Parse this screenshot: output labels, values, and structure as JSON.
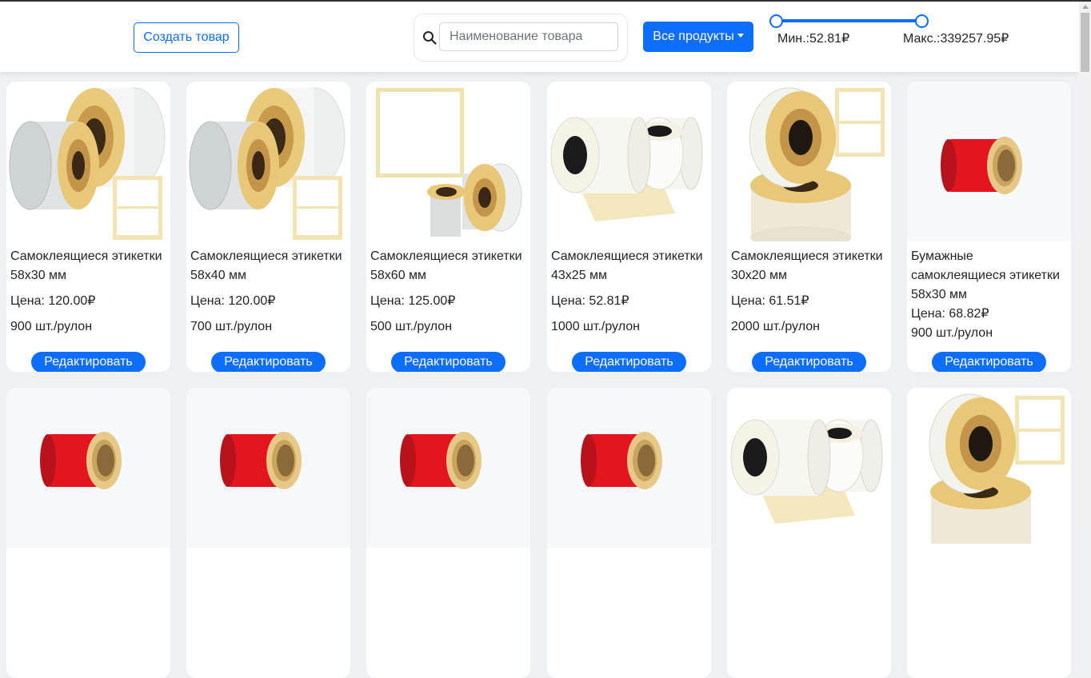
{
  "header": {
    "create_button": "Создать товар",
    "search": {
      "placeholder": "Наименование товара",
      "value": ""
    },
    "filter_button": "Все продукты",
    "price_slider": {
      "min_label": "Мин.:52.81₽",
      "max_label": "Макс.:339257.95₽",
      "min_value": 52.81,
      "max_value": 339257.95
    }
  },
  "colors": {
    "accent": "#0d6efd",
    "label_red": "#e3161f",
    "label_white": "#f5f6f2",
    "paper_core": "#d8c38a"
  },
  "products": [
    {
      "title": "Самоклеящиеся этикетки 58х30 мм",
      "price": "Цена: 120.00₽",
      "qty": "900 шт./рулон",
      "edit": "Редактировать",
      "image": "white-rolls-with-sheet"
    },
    {
      "title": "Самоклеящиеся этикетки 58х40 мм",
      "price": "Цена: 120.00₽",
      "qty": "700 шт./рулон",
      "edit": "Редактировать",
      "image": "white-rolls-with-sheet"
    },
    {
      "title": "Самоклеящиеся этикетки 58х60 мм",
      "price": "Цена: 125.00₽",
      "qty": "500 шт./рулон",
      "edit": "Редактировать",
      "image": "white-roll-with-big-sheet"
    },
    {
      "title": "Самоклеящиеся этикетки 43х25 мм",
      "price": "Цена: 52.81₽",
      "qty": "1000 шт./рулон",
      "edit": "Редактировать",
      "image": "white-rolls-unrolled"
    },
    {
      "title": "Самоклеящиеся этикетки 30х20 мм",
      "price": "Цена: 61.51₽",
      "qty": "2000 шт./рулон",
      "edit": "Редактировать",
      "image": "stacked-rolls-with-sheet"
    },
    {
      "title": "Бумажные самоклеящиеся этикетки 58х30 мм",
      "price": "Цена: 68.82₽",
      "qty": "900 шт./рулон",
      "edit": "Редактировать",
      "image": "red-roll"
    }
  ],
  "products_row2": [
    {
      "image": "red-roll"
    },
    {
      "image": "red-roll"
    },
    {
      "image": "red-roll"
    },
    {
      "image": "red-roll"
    },
    {
      "image": "white-rolls-unrolled"
    },
    {
      "image": "stacked-rolls-with-sheet"
    }
  ]
}
